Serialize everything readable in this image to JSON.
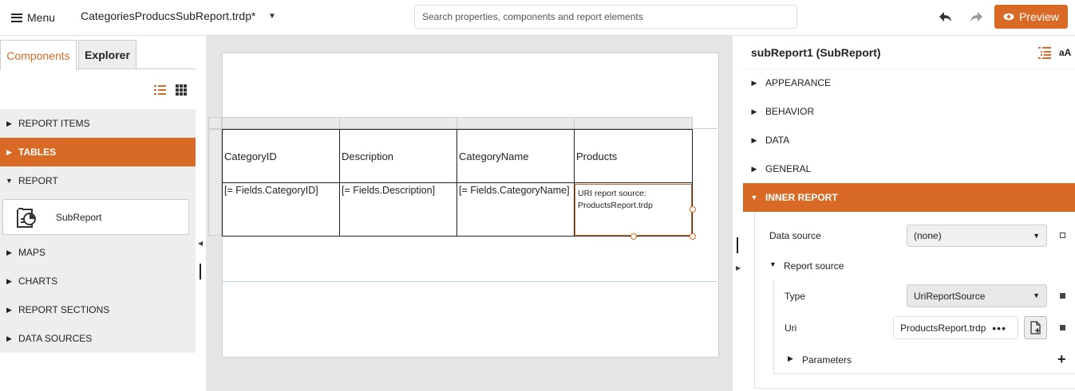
{
  "topbar": {
    "menu_label": "Menu",
    "document_title": "CategoriesProducsSubReport.trdp*",
    "search_placeholder": "Search properties, components and report elements",
    "preview_label": "Preview"
  },
  "left_panel": {
    "tabs": [
      "Components",
      "Explorer"
    ],
    "sections": [
      {
        "label": "REPORT ITEMS",
        "expanded": false
      },
      {
        "label": "TABLES",
        "expanded": false
      },
      {
        "label": "REPORT",
        "expanded": true
      },
      {
        "label": "MAPS",
        "expanded": false
      },
      {
        "label": "CHARTS",
        "expanded": false
      },
      {
        "label": "REPORT SECTIONS",
        "expanded": false
      },
      {
        "label": "DATA SOURCES",
        "expanded": false
      }
    ],
    "subreport_item": "SubReport"
  },
  "table": {
    "headers": [
      "CategoryID",
      "Description",
      "CategoryName",
      "Products"
    ],
    "row": [
      "[= Fields.CategoryID]",
      "[= Fields.Description]",
      "[= Fields.CategoryName]"
    ],
    "subreport_text_1": "URI report source:",
    "subreport_text_2": "ProductsReport.trdp"
  },
  "properties": {
    "title": "subReport1 (SubReport)",
    "font_toggle": "aA",
    "categories": [
      {
        "label": "APPEARANCE",
        "expanded": false
      },
      {
        "label": "BEHAVIOR",
        "expanded": false
      },
      {
        "label": "DATA",
        "expanded": false
      },
      {
        "label": "GENERAL",
        "expanded": false
      },
      {
        "label": "INNER REPORT",
        "expanded": true
      }
    ],
    "data_source_label": "Data source",
    "data_source_value": "(none)",
    "report_source_label": "Report source",
    "type_label": "Type",
    "type_value": "UriReportSource",
    "uri_label": "Uri",
    "uri_value": "ProductsReport.trdp",
    "uri_more": "•••",
    "parameters_label": "Parameters",
    "add_symbol": "+"
  },
  "colors": {
    "accent": "#d96a26",
    "section_gray": "#eeeeee",
    "canvas_bg": "#e5e5e5"
  }
}
